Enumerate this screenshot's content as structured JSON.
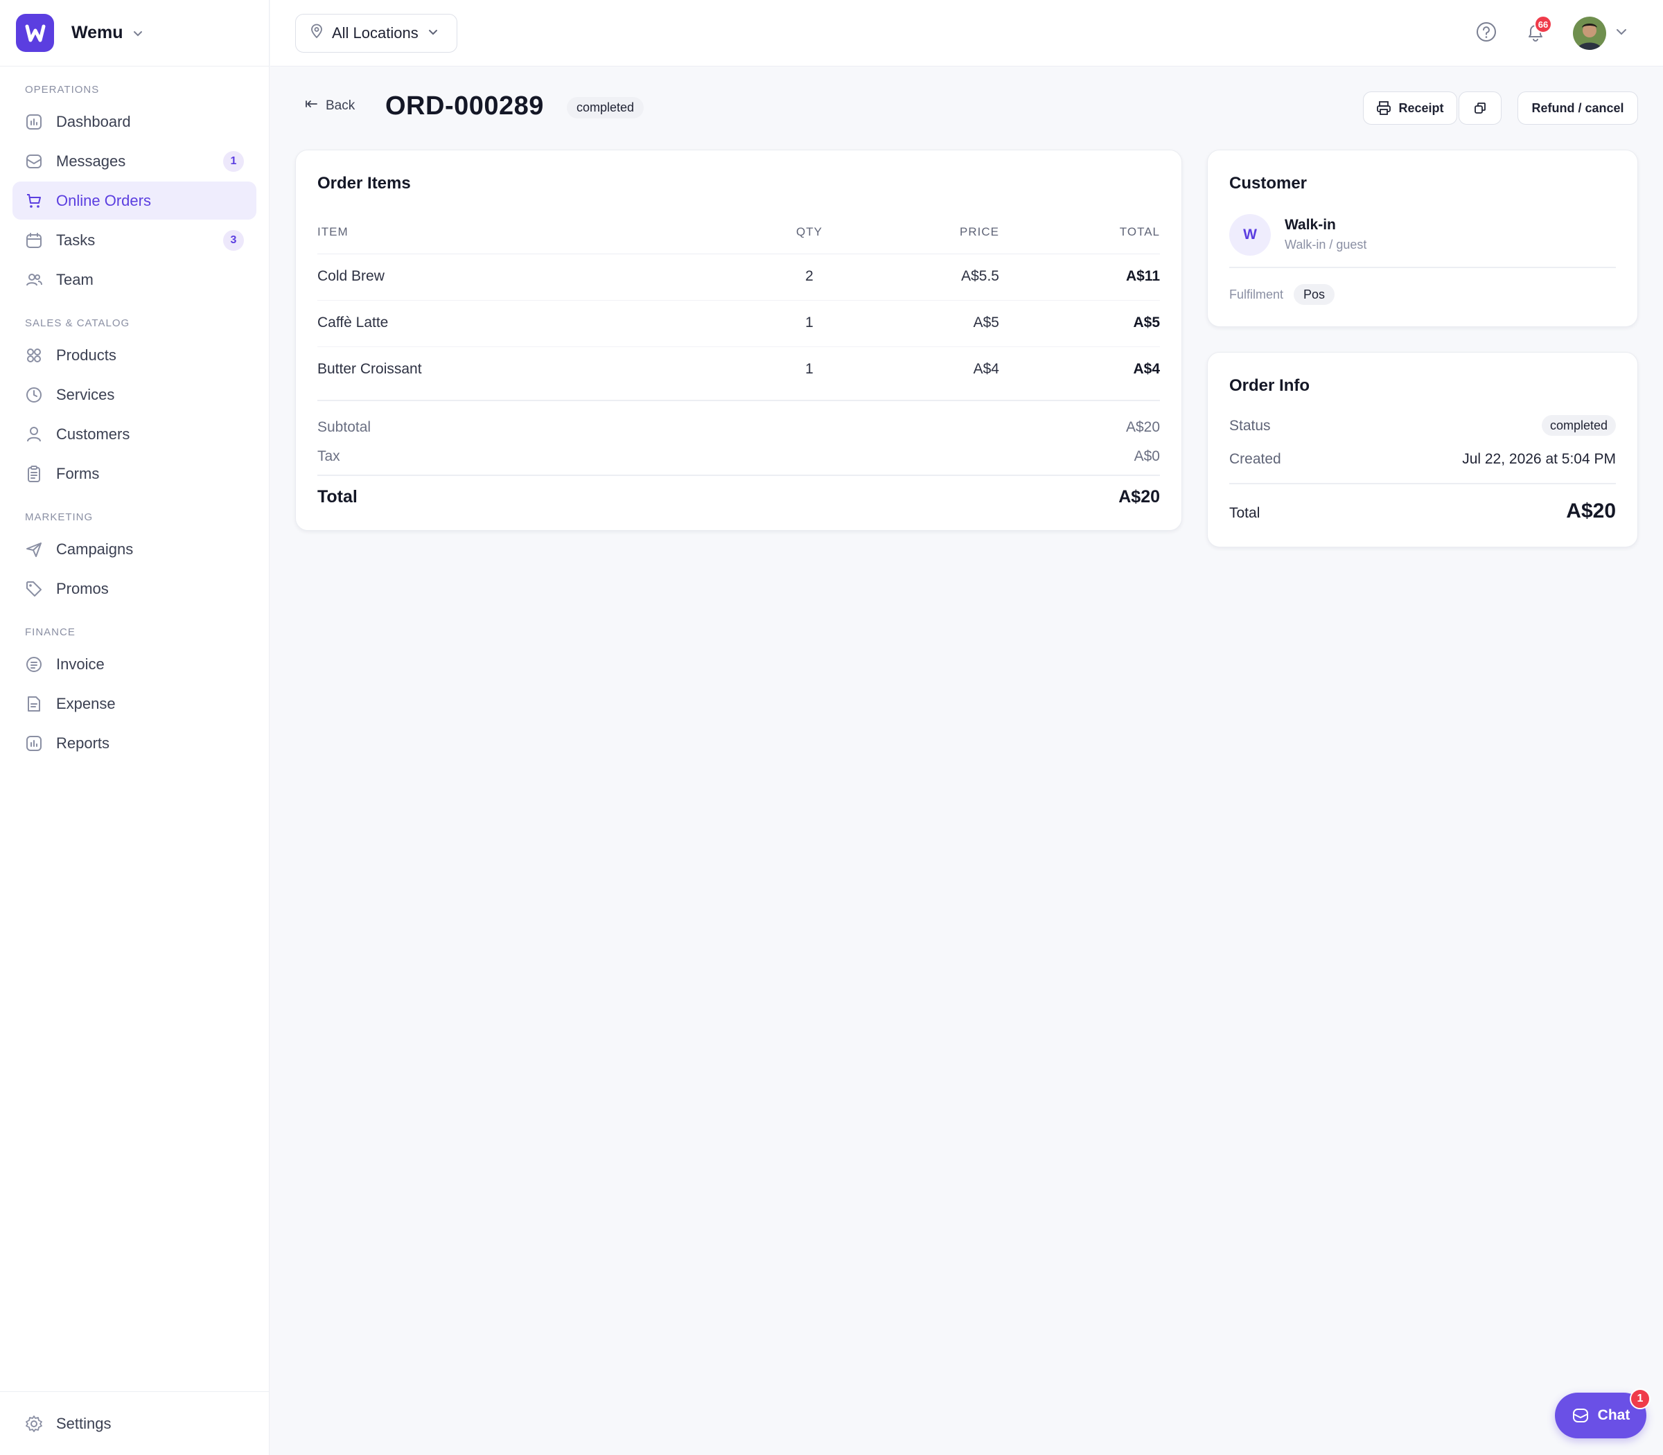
{
  "app": {
    "name": "Wemu"
  },
  "sidebar": {
    "sections": [
      {
        "label": "OPERATIONS",
        "items": [
          {
            "label": "Dashboard",
            "icon": "chart-icon"
          },
          {
            "label": "Messages",
            "icon": "inbox-icon",
            "badge": "1"
          },
          {
            "label": "Online Orders",
            "icon": "cart-icon",
            "active": true
          },
          {
            "label": "Tasks",
            "icon": "calendar-icon",
            "badge": "3"
          },
          {
            "label": "Team",
            "icon": "users-icon"
          }
        ]
      },
      {
        "label": "SALES & CATALOG",
        "items": [
          {
            "label": "Products",
            "icon": "grid-icon"
          },
          {
            "label": "Services",
            "icon": "clock-icon"
          },
          {
            "label": "Customers",
            "icon": "user-icon"
          },
          {
            "label": "Forms",
            "icon": "clipboard-icon"
          }
        ]
      },
      {
        "label": "MARKETING",
        "items": [
          {
            "label": "Campaigns",
            "icon": "send-icon"
          },
          {
            "label": "Promos",
            "icon": "tag-icon"
          }
        ]
      },
      {
        "label": "FINANCE",
        "items": [
          {
            "label": "Invoice",
            "icon": "invoice-icon"
          },
          {
            "label": "Expense",
            "icon": "expense-icon"
          },
          {
            "label": "Reports",
            "icon": "chart-icon"
          }
        ]
      }
    ],
    "settings_label": "Settings"
  },
  "topbar": {
    "location": "All Locations",
    "notifications_count": "66"
  },
  "page": {
    "back_label": "Back",
    "order_id": "ORD-000289",
    "status": "completed",
    "receipt_label": "Receipt",
    "refund_label": "Refund / cancel"
  },
  "order_items": {
    "title": "Order Items",
    "columns": [
      "ITEM",
      "QTY",
      "PRICE",
      "TOTAL"
    ],
    "rows": [
      {
        "item": "Cold Brew",
        "qty": "2",
        "price": "A$5.5",
        "total": "A$11"
      },
      {
        "item": "Caffè Latte",
        "qty": "1",
        "price": "A$5",
        "total": "A$5"
      },
      {
        "item": "Butter Croissant",
        "qty": "1",
        "price": "A$4",
        "total": "A$4"
      }
    ],
    "subtotal_label": "Subtotal",
    "subtotal": "A$20",
    "tax_label": "Tax",
    "tax": "A$0",
    "total_label": "Total",
    "total": "A$20"
  },
  "customer": {
    "title": "Customer",
    "initial": "W",
    "name": "Walk-in",
    "subtitle": "Walk-in / guest",
    "fulfilment_label": "Fulfilment",
    "fulfilment": "Pos"
  },
  "order_info": {
    "title": "Order Info",
    "status_label": "Status",
    "status": "completed",
    "created_label": "Created",
    "created": "Jul 22, 2026 at 5:04 PM",
    "total_label": "Total",
    "total": "A$20"
  },
  "chat": {
    "label": "Chat",
    "badge": "1"
  },
  "colors": {
    "accent": "#5b3ee0",
    "badge_red": "#ef3b4a",
    "background": "#f7f8fb"
  }
}
